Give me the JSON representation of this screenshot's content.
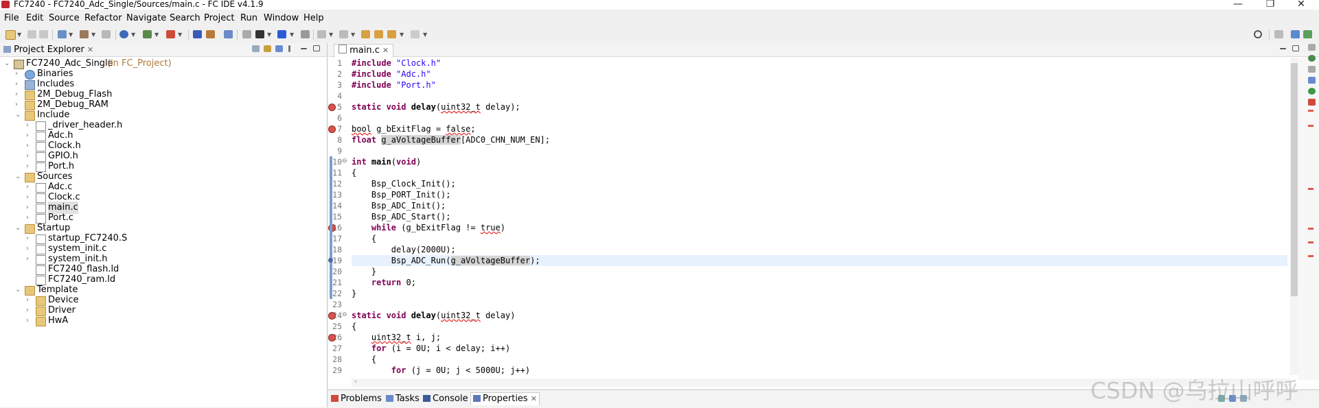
{
  "window": {
    "title": "FC7240 - FC7240_Adc_Single/Sources/main.c - FC IDE v4.1.9",
    "minimize": "—",
    "restore": "❐",
    "close": "✕"
  },
  "menu": [
    "File",
    "Edit",
    "Source",
    "Refactor",
    "Navigate",
    "Search",
    "Project",
    "Run",
    "Window",
    "Help"
  ],
  "explorer": {
    "tab_label": "Project Explorer",
    "tab_close": "✕",
    "tree": [
      {
        "label": "FC7240_Adc_Single",
        "hint": " (in FC_Project)",
        "icon": "project-icon",
        "twisty": "⌄"
      },
      {
        "label": "Binaries",
        "icon": "binaries-icon",
        "twisty": "›"
      },
      {
        "label": "Includes",
        "icon": "includes-icon",
        "twisty": "›"
      },
      {
        "label": "2M_Debug_Flash",
        "icon": "folder-icon",
        "twisty": "›"
      },
      {
        "label": "2M_Debug_RAM",
        "icon": "folder-icon",
        "twisty": "›"
      },
      {
        "label": "Include",
        "icon": "source-folder-icon",
        "twisty": "⌄"
      },
      {
        "label": "_driver_header.h",
        "icon": "header-file-icon",
        "twisty": "›"
      },
      {
        "label": "Adc.h",
        "icon": "header-file-icon",
        "twisty": "›"
      },
      {
        "label": "Clock.h",
        "icon": "header-file-icon",
        "twisty": "›"
      },
      {
        "label": "GPIO.h",
        "icon": "header-file-icon",
        "twisty": "›"
      },
      {
        "label": "Port.h",
        "icon": "header-file-icon",
        "twisty": "›"
      },
      {
        "label": "Sources",
        "icon": "source-folder-icon",
        "twisty": "⌄"
      },
      {
        "label": "Adc.c",
        "icon": "c-file-icon",
        "twisty": "›"
      },
      {
        "label": "Clock.c",
        "icon": "c-file-icon",
        "twisty": "›"
      },
      {
        "label": "main.c",
        "icon": "c-file-icon",
        "twisty": "›",
        "selected": true
      },
      {
        "label": "Port.c",
        "icon": "c-file-icon",
        "twisty": "›"
      },
      {
        "label": "Startup",
        "icon": "folder-icon",
        "twisty": "⌄"
      },
      {
        "label": "startup_FC7240.S",
        "icon": "asm-file-icon",
        "twisty": "›"
      },
      {
        "label": "system_init.c",
        "icon": "c-file-icon",
        "twisty": "›"
      },
      {
        "label": "system_init.h",
        "icon": "header-file-icon",
        "twisty": "›"
      },
      {
        "label": "FC7240_flash.ld",
        "icon": "linker-file-icon",
        "twisty": ""
      },
      {
        "label": "FC7240_ram.ld",
        "icon": "linker-file-icon",
        "twisty": ""
      },
      {
        "label": "Template",
        "icon": "folder-icon",
        "twisty": "⌄"
      },
      {
        "label": "Device",
        "icon": "folder-icon",
        "twisty": "›"
      },
      {
        "label": "Driver",
        "icon": "folder-icon",
        "twisty": "›"
      },
      {
        "label": "HwA",
        "icon": "folder-icon",
        "twisty": "›"
      }
    ]
  },
  "editor": {
    "tab_label": "main.c",
    "tab_close": "✕",
    "highlighted_line": 19,
    "lines": [
      [
        [
          "kw",
          "#include "
        ],
        [
          "str",
          "\"Clock.h\""
        ]
      ],
      [
        [
          "kw",
          "#include "
        ],
        [
          "str",
          "\"Adc.h\""
        ]
      ],
      [
        [
          "kw",
          "#include "
        ],
        [
          "str",
          "\"Port.h\""
        ]
      ],
      [],
      [
        [
          "kw",
          "static void "
        ],
        [
          "fn",
          "delay"
        ],
        [
          "",
          "("
        ],
        [
          "sq",
          "uint32_t"
        ],
        [
          "",
          " delay);"
        ]
      ],
      [],
      [
        [
          "sq",
          "bool"
        ],
        [
          "",
          " g_bExitFlag = "
        ],
        [
          "sq",
          "false"
        ],
        [
          "",
          ";"
        ]
      ],
      [
        [
          "kw",
          "float "
        ],
        [
          "occ",
          "g_aVoltageBuffer"
        ],
        [
          "",
          "[ADC0_CHN_NUM_EN];"
        ]
      ],
      [],
      [
        [
          "kw",
          "int "
        ],
        [
          "fn",
          "main"
        ],
        [
          "",
          "("
        ],
        [
          "kw",
          "void"
        ],
        [
          "",
          ")"
        ]
      ],
      [
        [
          "",
          "{"
        ]
      ],
      [
        [
          "",
          "    Bsp_Clock_Init();"
        ]
      ],
      [
        [
          "",
          "    Bsp_PORT_Init();"
        ]
      ],
      [
        [
          "",
          "    Bsp_ADC_Init();"
        ]
      ],
      [
        [
          "",
          "    Bsp_ADC_Start();"
        ]
      ],
      [
        [
          "kw",
          "    while "
        ],
        [
          "",
          "(g_bExitFlag != "
        ],
        [
          "sq",
          "true"
        ],
        [
          "",
          ")"
        ]
      ],
      [
        [
          "",
          "    {"
        ]
      ],
      [
        [
          "",
          "        delay(2000U);"
        ]
      ],
      [
        [
          "",
          "        Bsp_ADC_Run("
        ],
        [
          "occ",
          "g_aVoltageBuffer"
        ],
        [
          "",
          ");"
        ]
      ],
      [
        [
          "",
          "    }"
        ]
      ],
      [
        [
          "kw",
          "    return "
        ],
        [
          "",
          "0;"
        ]
      ],
      [
        [
          "",
          "}"
        ]
      ],
      [],
      [
        [
          "kw",
          "static void "
        ],
        [
          "fn",
          "delay"
        ],
        [
          "",
          "("
        ],
        [
          "sq",
          "uint32_t"
        ],
        [
          "",
          " delay)"
        ]
      ],
      [
        [
          "",
          "{"
        ]
      ],
      [
        [
          "",
          "    "
        ],
        [
          "sq",
          "uint32_t"
        ],
        [
          "",
          " i, j;"
        ]
      ],
      [
        [
          "kw",
          "    for "
        ],
        [
          "",
          "(i = 0U; i < delay; i++)"
        ]
      ],
      [
        [
          "",
          "    {"
        ]
      ],
      [
        [
          "kw",
          "        for "
        ],
        [
          "",
          "(j = 0U; j < 5000U; j++)"
        ]
      ]
    ],
    "line_numbers": [
      "1",
      "2",
      "3",
      "4",
      "5",
      "6",
      "7",
      "8",
      "9",
      "10",
      "11",
      "12",
      "13",
      "14",
      "15",
      "16",
      "17",
      "18",
      "19",
      "20",
      "21",
      "22",
      "23",
      "24",
      "25",
      "26",
      "27",
      "28",
      "29"
    ]
  },
  "bottom_tabs": [
    "Problems",
    "Tasks",
    "Console",
    "Properties"
  ],
  "bottom_tab_close": "✕",
  "watermark": "CSDN @乌拉山呼呼",
  "colors": {
    "keyword": "#7f0055",
    "string": "#2a00ff",
    "linenum": "#787878",
    "highlight": "#e8f2fe",
    "error": "#d9534f"
  }
}
